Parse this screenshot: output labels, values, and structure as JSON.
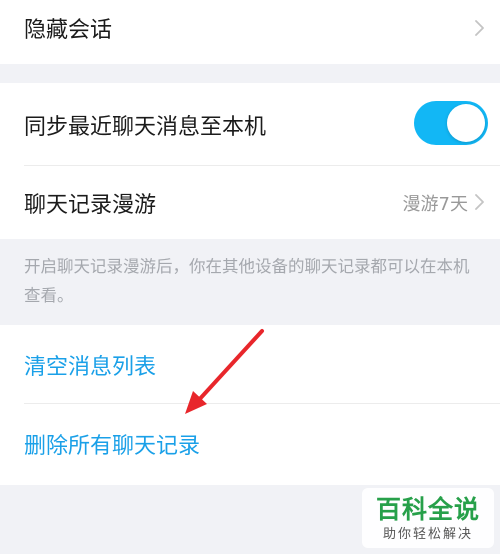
{
  "hidden_sessions": {
    "label": "隐藏会话"
  },
  "sync_recent": {
    "label": "同步最近聊天消息至本机",
    "enabled": true
  },
  "roaming": {
    "label": "聊天记录漫游",
    "value": "漫游7天"
  },
  "roaming_hint": "开启聊天记录漫游后，你在其他设备的聊天记录都可以在本机查看。",
  "actions": {
    "clear_list": "清空消息列表",
    "delete_all": "删除所有聊天记录"
  },
  "watermark": {
    "title": "百科全说",
    "subtitle": "助你轻松解决"
  },
  "colors": {
    "accent_blue": "#1aa0e8",
    "toggle_on": "#12b7f5",
    "annotation_arrow": "#e8262b",
    "watermark_green": "#27a04a"
  }
}
